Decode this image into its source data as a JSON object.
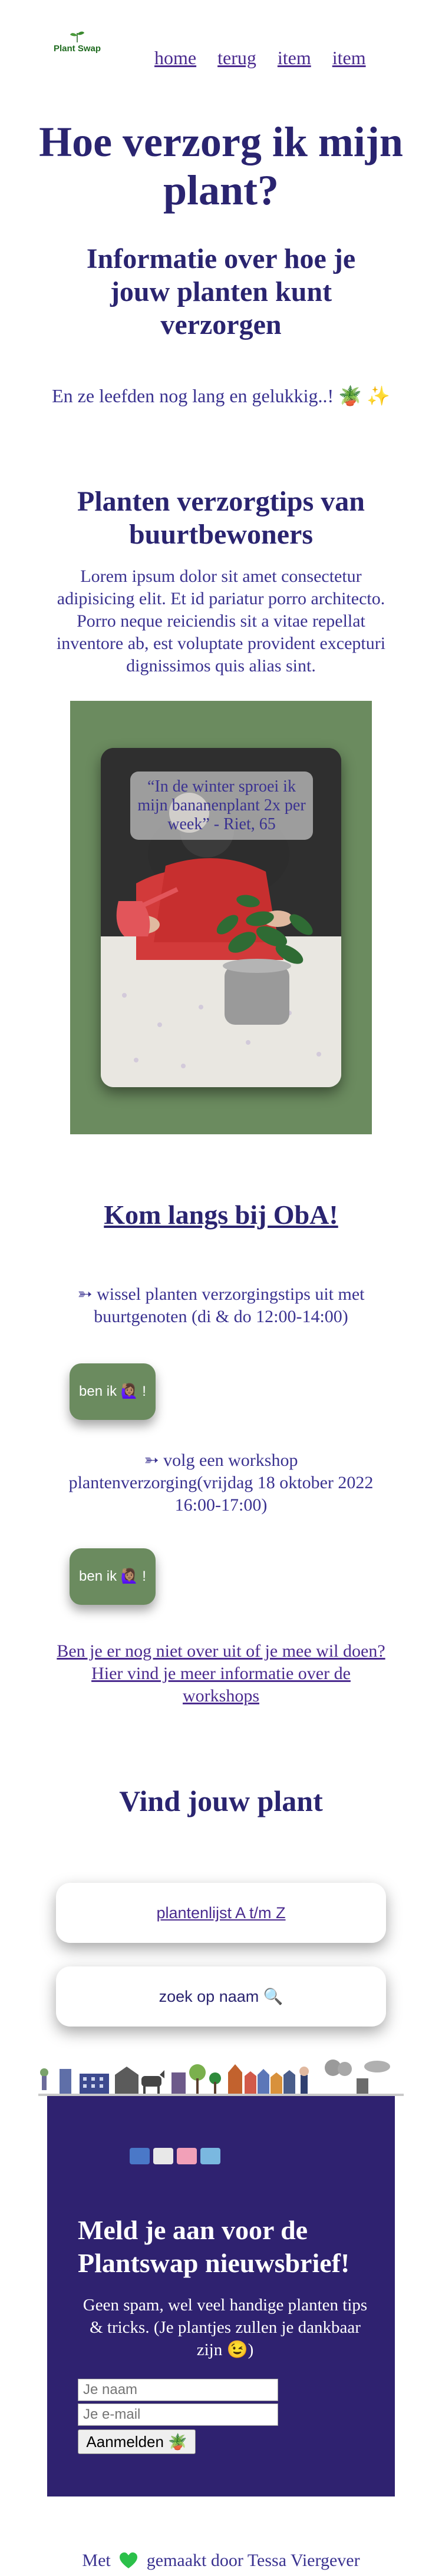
{
  "header": {
    "logo_text": "Plant Swap",
    "nav": [
      "home",
      "terug",
      "item",
      "item"
    ]
  },
  "hero": {
    "title": "Hoe verzorg ik mijn plant?",
    "subtitle": "Informatie over hoe je jouw planten kunt verzorgen",
    "intro": "En ze leefden nog lang en gelukkig..! 🪴 ✨"
  },
  "tips": {
    "title": "Planten verzorgtips van buurtbewoners",
    "body": "Lorem ipsum dolor sit amet consectetur adipisicing elit. Et id pariatur porro architecto. Porro neque reiciendis sit a vitae repellat inventore ab, est voluptate provident excepturi dignissimos quis alias sint.",
    "quote": "“In de winter sproei ik mijn bananenplant 2x per week” - Riet, 65"
  },
  "oba": {
    "title": "Kom langs bij ObA!",
    "item1": "➳ wissel planten verzorgingstips uit met buurtgenoten (di & do 12:00-14:00)",
    "button1": "ben ik 🙋🏽‍♀️ !",
    "item2": "➳ volg een workshop plantenverzorging(vrijdag 18 oktober 2022 16:00-17:00)",
    "button2": "ben ik 🙋🏽‍♀️ !",
    "link": "Ben je er nog niet over uit of je mee wil doen? Hier vind je meer informatie over de workshops"
  },
  "find": {
    "title": "Vind jouw plant",
    "list_link": "plantenlijst A t/m Z",
    "search_label": "zoek op naam 🔍"
  },
  "newsletter": {
    "title": "Meld je aan voor de Plantswap nieuwsbrief!",
    "text": "Geen spam, wel veel handige planten tips & tricks. (Je plantjes zullen je dankbaar zijn 😉)",
    "name_placeholder": "Je naam",
    "email_placeholder": "Je e-mail",
    "submit_label": "Aanmelden 🪴"
  },
  "footer": {
    "before": "Met",
    "after": "gemaakt door Tessa Viergever"
  },
  "colors": {
    "primary": "#2a2470",
    "green": "#6b8b5f",
    "newsletter_bg": "#2f2270",
    "heart": "#2bc04a"
  }
}
